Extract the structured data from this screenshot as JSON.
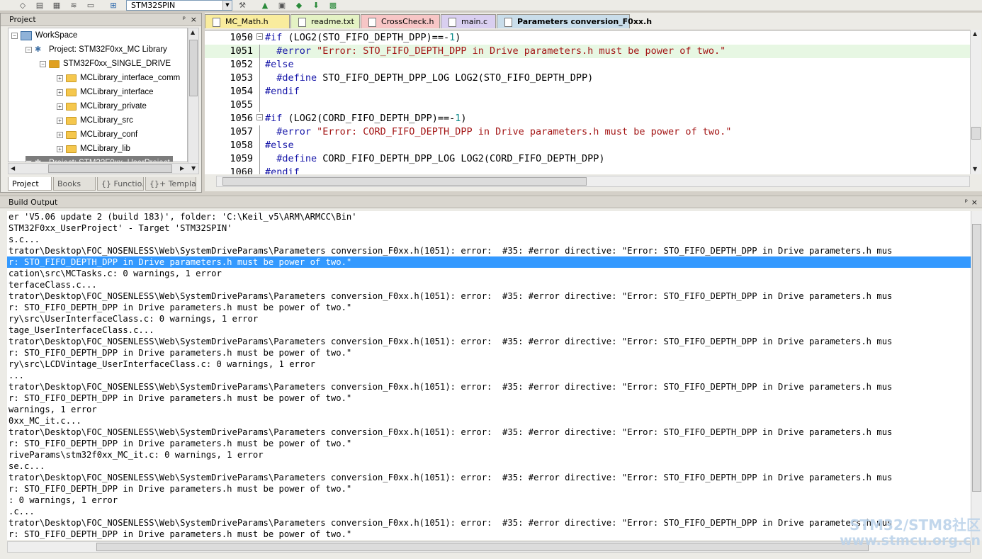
{
  "toolbar": {
    "target": "STM32SPIN"
  },
  "project_panel": {
    "title": "Project",
    "pin": "ᵖ",
    "close": "×",
    "tree": [
      {
        "label": "WorkSpace"
      },
      {
        "label": "Project: STM32F0xx_MC Library"
      },
      {
        "label": "STM32F0xx_SINGLE_DRIVE"
      },
      {
        "label": "MCLibrary_interface_comm"
      },
      {
        "label": "MCLibrary_interface"
      },
      {
        "label": "MCLibrary_private"
      },
      {
        "label": "MCLibrary_src"
      },
      {
        "label": "MCLibrary_conf"
      },
      {
        "label": "MCLibrary_lib"
      },
      {
        "label": "Project: STM32F0xx_UserProject"
      }
    ],
    "tabs": [
      "Project",
      "Books",
      "{} Functio...",
      "{}+ Templa..."
    ]
  },
  "editor": {
    "tabs": [
      "MC_Math.h",
      "readme.txt",
      "CrossCheck.h",
      "main.c",
      "Parameters conversion_F0xx.h"
    ],
    "tab_colors": [
      "#f9ec9d",
      "#e4f2c4",
      "#f7c6c6",
      "#d9cff0",
      "#c9ddea"
    ],
    "lines": [
      {
        "num": "1050",
        "pre": "#if",
        "rest": " (LOG2(STO_FIFO_DEPTH_DPP)==-",
        "num_tail": "1",
        "end": ")"
      },
      {
        "num": "1051",
        "indent": "  ",
        "pre": "#error",
        "str": " \"Error: STO_FIFO_DEPTH_DPP in Drive parameters.h must be power of two.\""
      },
      {
        "num": "1052",
        "pre": "#else"
      },
      {
        "num": "1053",
        "indent": "  ",
        "pre": "#define",
        "rest": " STO_FIFO_DEPTH_DPP_LOG LOG2(STO_FIFO_DEPTH_DPP)"
      },
      {
        "num": "1054",
        "pre": "#endif"
      },
      {
        "num": "1055"
      },
      {
        "num": "1056",
        "pre": "#if",
        "rest": " (LOG2(CORD_FIFO_DEPTH_DPP)==-",
        "num_tail": "1",
        "end": ")"
      },
      {
        "num": "1057",
        "indent": "  ",
        "pre": "#error",
        "str": " \"Error: CORD_FIFO_DEPTH_DPP in Drive parameters.h must be power of two.\""
      },
      {
        "num": "1058",
        "pre": "#else"
      },
      {
        "num": "1059",
        "indent": "  ",
        "pre": "#define",
        "rest": " CORD_FIFO_DEPTH_DPP_LOG LOG2(CORD_FIFO_DEPTH_DPP)"
      },
      {
        "num": "1060",
        "pre": "#endif"
      }
    ]
  },
  "build_output": {
    "title": "Build Output",
    "pin": "ᵖ",
    "close": "×",
    "lines": [
      "er 'V5.06 update 2 (build 183)', folder: 'C:\\Keil_v5\\ARM\\ARMCC\\Bin'",
      "STM32F0xx_UserProject' - Target 'STM32SPIN'",
      "s.c...",
      "trator\\Desktop\\FOC_NOSENLESS\\Web\\SystemDriveParams\\Parameters conversion_F0xx.h(1051): error:  #35: #error directive: \"Error: STO_FIFO_DEPTH_DPP in Drive parameters.h mus",
      "r: STO_FIFO_DEPTH_DPP in Drive parameters.h must be power of two.\"",
      "cation\\src\\MCTasks.c: 0 warnings, 1 error",
      "terfaceClass.c...",
      "trator\\Desktop\\FOC_NOSENLESS\\Web\\SystemDriveParams\\Parameters conversion_F0xx.h(1051): error:  #35: #error directive: \"Error: STO_FIFO_DEPTH_DPP in Drive parameters.h mus",
      "r: STO_FIFO_DEPTH_DPP in Drive parameters.h must be power of two.\"",
      "ry\\src\\UserInterfaceClass.c: 0 warnings, 1 error",
      "tage_UserInterfaceClass.c...",
      "trator\\Desktop\\FOC_NOSENLESS\\Web\\SystemDriveParams\\Parameters conversion_F0xx.h(1051): error:  #35: #error directive: \"Error: STO_FIFO_DEPTH_DPP in Drive parameters.h mus",
      "r: STO_FIFO_DEPTH_DPP in Drive parameters.h must be power of two.\"",
      "ry\\src\\LCDVintage_UserInterfaceClass.c: 0 warnings, 1 error",
      "...",
      "trator\\Desktop\\FOC_NOSENLESS\\Web\\SystemDriveParams\\Parameters conversion_F0xx.h(1051): error:  #35: #error directive: \"Error: STO_FIFO_DEPTH_DPP in Drive parameters.h mus",
      "r: STO_FIFO_DEPTH_DPP in Drive parameters.h must be power of two.\"",
      "warnings, 1 error",
      "0xx_MC_it.c...",
      "trator\\Desktop\\FOC_NOSENLESS\\Web\\SystemDriveParams\\Parameters conversion_F0xx.h(1051): error:  #35: #error directive: \"Error: STO_FIFO_DEPTH_DPP in Drive parameters.h mus",
      "r: STO_FIFO_DEPTH_DPP in Drive parameters.h must be power of two.\"",
      "riveParams\\stm32f0xx_MC_it.c: 0 warnings, 1 error",
      "se.c...",
      "trator\\Desktop\\FOC_NOSENLESS\\Web\\SystemDriveParams\\Parameters conversion_F0xx.h(1051): error:  #35: #error directive: \"Error: STO_FIFO_DEPTH_DPP in Drive parameters.h mus",
      "r: STO_FIFO_DEPTH_DPP in Drive parameters.h must be power of two.\"",
      ": 0 warnings, 1 error",
      ".c...",
      "trator\\Desktop\\FOC_NOSENLESS\\Web\\SystemDriveParams\\Parameters conversion_F0xx.h(1051): error:  #35: #error directive: \"Error: STO_FIFO_DEPTH_DPP in Drive parameters.h mus",
      "r: STO_FIFO_DEPTH_DPP in Drive parameters.h must be power of two.\""
    ]
  },
  "watermark": {
    "line1": "STM32/STM8社区",
    "line2": "www.stmcu.org.cn"
  }
}
